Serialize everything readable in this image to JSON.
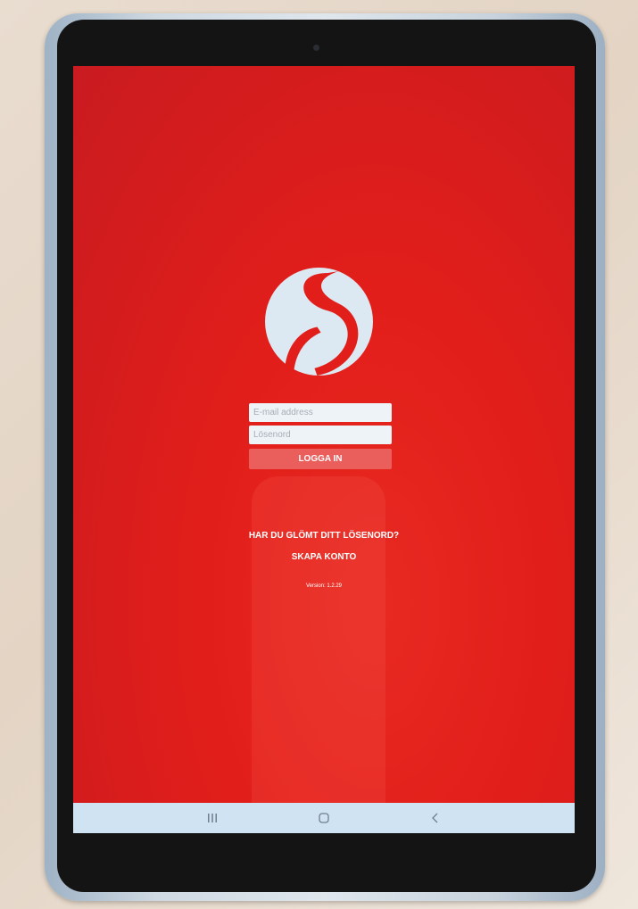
{
  "login": {
    "email_placeholder": "E-mail address",
    "password_placeholder": "Lösenord",
    "login_label": "LOGGA IN",
    "forgot_password_label": "HAR DU GLÖMT DITT LÖSENORD?",
    "create_account_label": "SKAPA KONTO",
    "version_text": "Version: 1.2.29"
  },
  "navbar": {
    "recent_icon": "recent-apps-icon",
    "home_icon": "home-icon",
    "back_icon": "back-icon"
  },
  "colors": {
    "background": "#e21e1a",
    "logo": "#dce9f2",
    "button": "#ea5e5c",
    "navbar": "#cfe3f2"
  }
}
